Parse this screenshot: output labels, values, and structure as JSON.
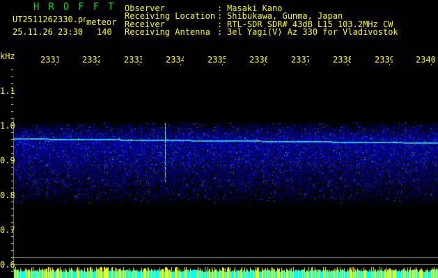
{
  "header": {
    "app_title": "HROFFT",
    "filename": "UT2511262330.png",
    "mode": "meteor",
    "datetime": "25.11.26 23:30",
    "count": "140",
    "info": [
      {
        "label": "Observer",
        "value": "Masaki Kano"
      },
      {
        "label": "Receiving Location",
        "value": "Shibukawa, Gunma, Japan"
      },
      {
        "label": "Receiver",
        "value": "RTL-SDR SDR# 43dB L15 103.2MHz CW"
      },
      {
        "label": "Receiving Antenna",
        "value": "3el Yagi(V) Az 330 for Vladivostok"
      }
    ]
  },
  "axis": {
    "y_unit": "kHz",
    "y_ticks": [
      "1.1",
      "1.0",
      "0.9",
      "0.8",
      "0.7",
      "0.6"
    ],
    "time_ticks": [
      "2331",
      "2332",
      "2333",
      "2334",
      "2335",
      "2336",
      "2337",
      "2338",
      "2339",
      "2340"
    ]
  },
  "colors": {
    "text": "#ffff00",
    "title": "#00e000",
    "signal": "#00ffff",
    "noise": "#0000c0"
  }
}
